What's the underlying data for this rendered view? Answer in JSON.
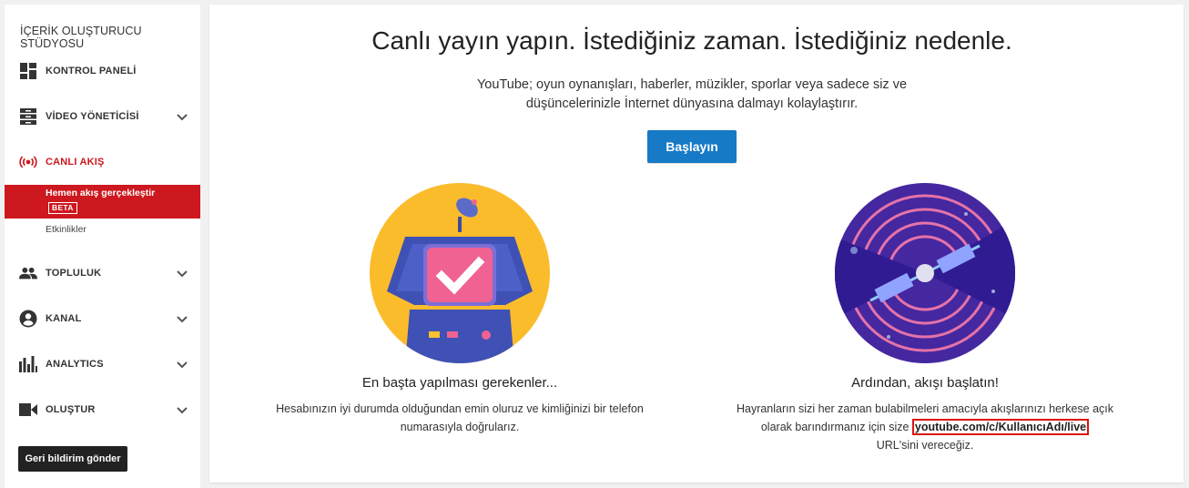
{
  "sidebar": {
    "studio_title": "İÇERİK OLUŞTURUCU STÜDYOSU",
    "items": [
      {
        "label": "KONTROL PANELİ",
        "icon": "dashboard-icon"
      },
      {
        "label": "VİDEO YÖNETİCİSİ",
        "icon": "video-manager-icon"
      },
      {
        "label": "CANLI AKIŞ",
        "icon": "live-stream-icon"
      },
      {
        "label": "TOPLULUK",
        "icon": "community-icon"
      },
      {
        "label": "KANAL",
        "icon": "channel-icon"
      },
      {
        "label": "ANALYTICS",
        "icon": "analytics-icon"
      },
      {
        "label": "OLUŞTUR",
        "icon": "create-icon"
      }
    ],
    "live_sub": {
      "active_label": "Hemen akış gerçekleştir",
      "beta_badge": "BETA",
      "events_label": "Etkinlikler"
    },
    "feedback_button": "Geri bildirim gönder"
  },
  "main": {
    "headline": "Canlı yayın yapın. İstediğiniz zaman. İstediğiniz nedenle.",
    "intro": "YouTube; oyun oynanışları, haberler, müzikler, sporlar veya sadece siz ve düşüncelerinizle İnternet dünyasına dalmayı kolaylaştırır.",
    "start_button": "Başlayın",
    "left_col": {
      "title": "En başta yapılması gerekenler...",
      "text": "Hesabınızın iyi durumda olduğundan emin oluruz ve kimliğinizi bir telefon numarasıyla doğrularız."
    },
    "right_col": {
      "title": "Ardından, akışı başlatın!",
      "text_before": "Hayranların sizi her zaman bulabilmeleri amacıyla akışlarınızı herkese açık olarak barındırmanız için size ",
      "url": "youtube.com/c/KullanıcıAdı/live",
      "text_after": " URL'sini vereceğiz."
    }
  },
  "colors": {
    "accent_red": "#cc181e",
    "button_blue": "#167ac6",
    "highlight_border": "#dd1111"
  }
}
